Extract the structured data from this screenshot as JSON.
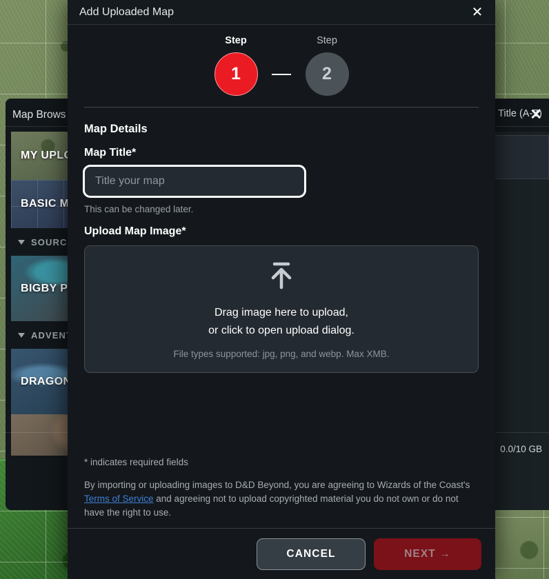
{
  "background": {
    "browser": {
      "title": "Map Brows",
      "close_icon": "close-icon",
      "tiles": [
        {
          "label": "MY UPLOA"
        },
        {
          "label": "BASIC MA"
        },
        {
          "label": "BIGBY PI"
        },
        {
          "label": "DRAGON"
        }
      ],
      "sections": [
        {
          "label": "SOURCE"
        },
        {
          "label": "ADVENTU"
        }
      ],
      "sort_label": "Title (A-Z)",
      "storage_text": "0.0/10 GB"
    }
  },
  "modal": {
    "title": "Add Uploaded Map",
    "close_icon": "close-icon",
    "stepper": {
      "steps": [
        {
          "word": "Step",
          "number": "1",
          "state": "active"
        },
        {
          "word": "Step",
          "number": "2",
          "state": "inactive"
        }
      ]
    },
    "form": {
      "section_title": "Map Details",
      "map_title_label": "Map Title*",
      "map_title_value": "",
      "map_title_placeholder": "Title your map",
      "map_title_helper": "This can be changed later.",
      "upload_label": "Upload Map Image*",
      "upload_icon": "upload-arrow-icon",
      "drop_line_1": "Drag image here to upload,",
      "drop_line_2": "or click to open upload dialog.",
      "drop_filetypes": "File types supported: jpg, png, and webp. Max XMB."
    },
    "legal": {
      "required_note": "* indicates required fields",
      "text_before": "By importing or uploading images to D&D Beyond, you are agreeing to Wizards of the Coast's ",
      "link_text": "Terms of Service",
      "text_after": " and agreeing not to upload copyrighted material you do not own or do not have the right to use."
    },
    "footer": {
      "cancel_label": "CANCEL",
      "next_label": "NEXT →"
    }
  },
  "colors": {
    "accent_red": "#eb1b23",
    "next_disabled_bg": "#7b1119",
    "link_blue": "#3d7fd4",
    "panel_bg": "#14181c",
    "field_bg": "#242a31"
  }
}
